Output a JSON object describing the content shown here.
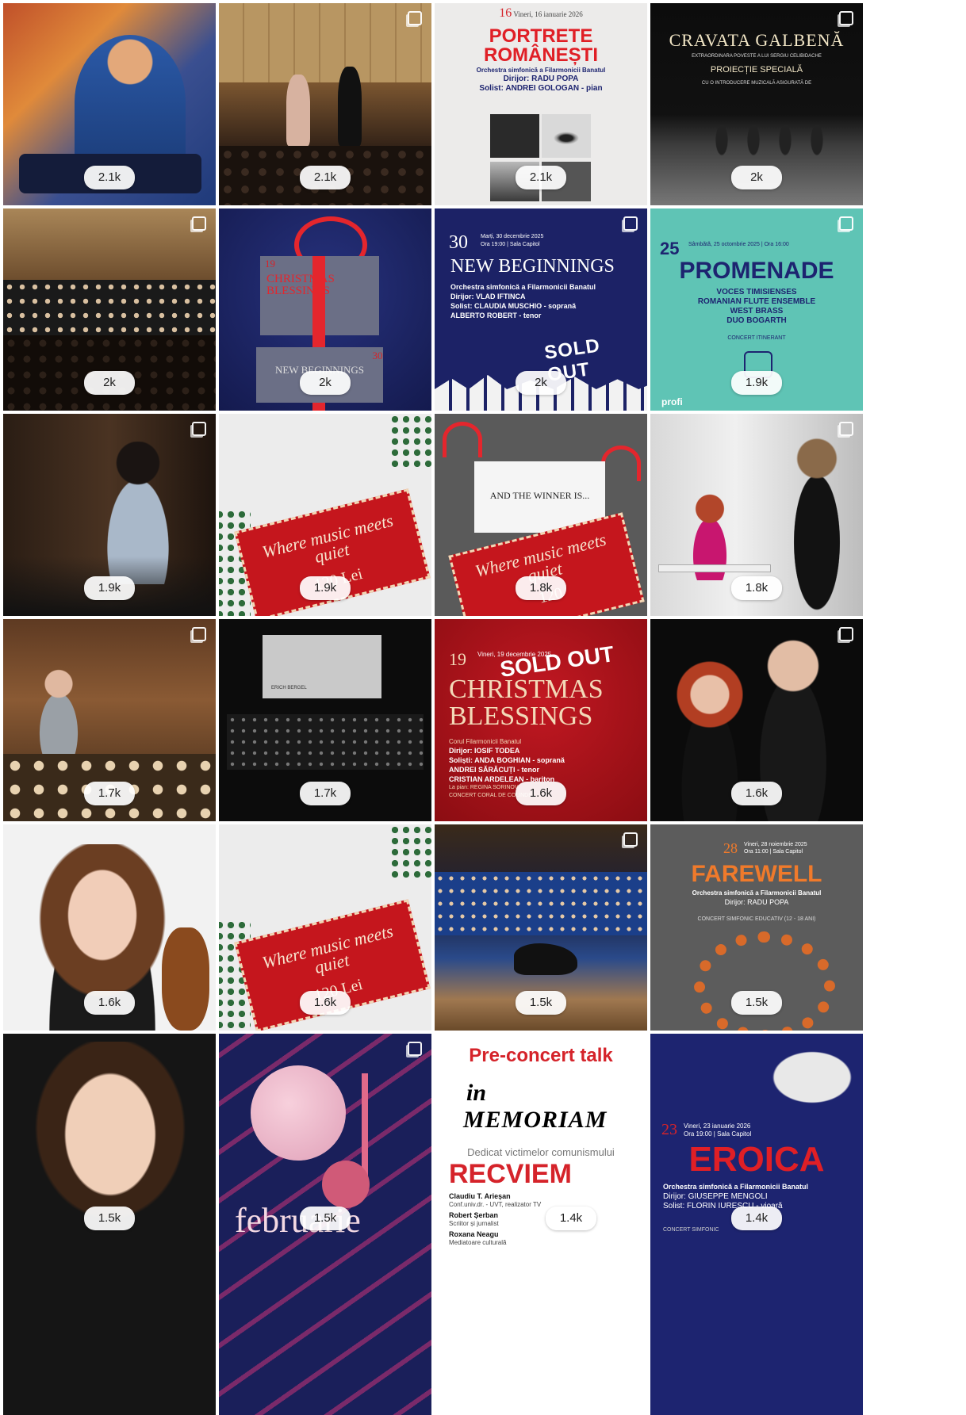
{
  "posts": [
    {
      "count": "2.1k"
    },
    {
      "count": "2.1k"
    },
    {
      "count": "2.1k",
      "day": "16",
      "dateline": "Vineri, 16 ianuarie 2026",
      "time_place": "Ora 19:00 | Sala Capitol",
      "title": "PORTRETE ROMÂNEȘTI",
      "orchestra": "Orchestra simfonică a Filarmonicii Banatul",
      "conductor": "Dirijor: RADU POPA",
      "soloist": "Solist: ANDREI GOLOGAN - pian"
    },
    {
      "count": "2k",
      "title": "CRAVATA GALBENĂ",
      "subtitle": "EXTRAORDINARA POVESTE A LUI SERGIU CELIBIDACHE",
      "line1": "PROIECȚIE SPECIALĂ",
      "line2": "CU O INTRODUCERE MUZICALĂ ASIGURATĂ DE"
    },
    {
      "count": "2k"
    },
    {
      "count": "2k",
      "day": "19",
      "title": "CHRISTMAS BLESSINGS",
      "title2": "NEW BEGINNINGS",
      "day2": "30"
    },
    {
      "count": "2k",
      "day": "30",
      "dateline": "Marți, 30 decembrie 2025",
      "time_place": "Ora 19:00 | Sala Capitol",
      "title": "NEW BEGINNINGS",
      "orchestra": "Orchestra simfonică a Filarmonicii Banatul",
      "conductor": "Dirijor: VLAD IFTINCA",
      "soloist1": "Solist: CLAUDIA MUSCHIO - soprană",
      "soloist2": "ALBERTO ROBERT - tenor",
      "sold": "SOLD OUT"
    },
    {
      "count": "1.9k",
      "day": "25",
      "dateline": "Sâmbătă, 25 octombrie 2025 | Ora 16:00",
      "title": "PROMENADE",
      "l1": "VOCES TIMISIENSES",
      "l2": "ROMANIAN FLUTE ENSEMBLE",
      "l3": "WEST BRASS",
      "l4": "DUO BOGARTH",
      "l5": "CONCERT ITINERANT",
      "sponsor": "profi"
    },
    {
      "count": "1.9k"
    },
    {
      "count": "1.9k",
      "title": "Where music meets quiet",
      "price": "120 Lei"
    },
    {
      "count": "1.8k",
      "card": "AND THE WINNER IS...",
      "title": "Where music meets quiet",
      "price": "120"
    },
    {
      "count": "1.8k"
    },
    {
      "count": "1.7k"
    },
    {
      "count": "1.7k",
      "author": "ERICH BERGEL"
    },
    {
      "count": "1.6k",
      "day": "19",
      "dateline": "Vineri, 19 decembrie 2025",
      "title": "CHRISTMAS BLESSINGS",
      "sold": "SOLD OUT",
      "choir": "Corul Filarmonicii Banatul",
      "conductor": "Dirijor: IOSIF TODEA",
      "s1": "Soliști: ANDA BOGHIAN - soprană",
      "s2": "ANDREI SĂRĂCUȚI - tenor",
      "s3": "CRISTIAN ARDELEAN - bariton",
      "piano": "La pian: REGINA SORINOV",
      "concert": "CONCERT CORAL DE COLINDE"
    },
    {
      "count": "1.6k"
    },
    {
      "count": "1.6k"
    },
    {
      "count": "1.6k",
      "title": "Where music meets quiet",
      "price": "120 Lei"
    },
    {
      "count": "1.5k"
    },
    {
      "count": "1.5k",
      "day": "28",
      "dateline": "Vineri, 28 noiembrie 2025",
      "time_place": "Ora 11:00 | Sala Capitol",
      "title": "FAREWELL",
      "orchestra": "Orchestra simfonică a Filarmonicii Banatul",
      "conductor": "Dirijor: RADU POPA",
      "concert": "CONCERT SIMFONIC EDUCATIV (12 - 18 ANI)"
    },
    {
      "count": "1.5k"
    },
    {
      "count": "1.5k",
      "title": "februarie"
    },
    {
      "count": "1.4k",
      "head": "Pre-concert talk",
      "art1": "in",
      "art2": "MEMORIAM",
      "ded": "Dedicat victimelor comunismului",
      "title": "RECVIEM",
      "p1": "Claudiu T. Arieșan",
      "p1r": "Conf.univ.dr. - UVT, realizator TV",
      "p2": "Robert Șerban",
      "p2r": "Scriitor și jurnalist",
      "p3": "Roxana Neagu",
      "p3r": "Mediatoare culturală"
    },
    {
      "count": "1.4k",
      "day": "23",
      "dateline": "Vineri, 23 ianuarie 2026",
      "time_place": "Ora 19:00 | Sala Capitol",
      "title": "EROICA",
      "orchestra": "Orchestra simfonică a Filarmonicii Banatul",
      "conductor": "Dirijor: GIUSEPPE MENGOLI",
      "soloist": "Solist: FLORIN IURESCU - vioară",
      "concert": "CONCERT SIMFONIC"
    }
  ],
  "colors": {
    "accent_red": "#d5232a",
    "navy": "#1d2470",
    "teal": "#5fc4b5",
    "orange": "#f07a2b"
  },
  "icons": {
    "multi_post": "carousel-icon"
  }
}
